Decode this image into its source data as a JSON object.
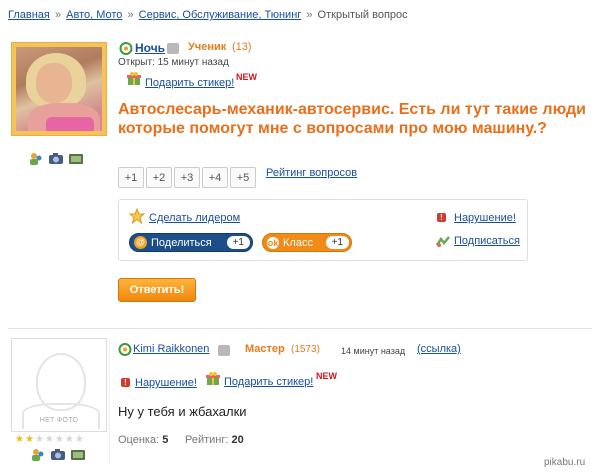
{
  "breadcrumb": {
    "items": [
      "Главная",
      "Авто, Мото",
      "Сервис, Обслуживание, Тюнинг"
    ],
    "sep1": "»",
    "sep2": "»",
    "sep3": "»",
    "current": "Открытый вопрос"
  },
  "question": {
    "user_name": "Ночь",
    "rank": "Ученик",
    "rank_points": "(13)",
    "opened": "Открыт: 15 минут назад",
    "gift_label": "Подарить стикер!",
    "new_badge": "NEW",
    "title": "Автослесарь-механик-автосервис. Есть ли тут такие люди которые помогут мне с вопросами про мою машину.?",
    "votes": [
      "+1",
      "+2",
      "+3",
      "+4",
      "+5"
    ],
    "rating_link": "Рейтинг вопросов",
    "make_leader": "Сделать лидером",
    "violation": "Нарушение!",
    "share_label": "Поделиться",
    "share_count": "+1",
    "ok_label": "Класс",
    "ok_count": "+1",
    "subscribe": "Подписаться",
    "answer_button": "Ответить!"
  },
  "answer": {
    "user_name": "Kimi Raikkonen",
    "rank": "Мастер",
    "rank_points": "(1573)",
    "time": "14 минут назад",
    "link": "(ссылка)",
    "violation": "Нарушение!",
    "gift_label": "Подарить стикер!",
    "new_badge": "NEW",
    "text": "Ну у тебя и жбахалки",
    "score_label": "Оценка:",
    "score_value": "5",
    "rating_label": "Рейтинг:",
    "rating_value": "20",
    "stars": 2,
    "stars_total": 7,
    "no_photo": "НЕТ ФОТО"
  },
  "watermark": "pikabu.ru",
  "colors": {
    "link": "#1a4ea0",
    "accent_orange": "#e8701d",
    "share_blue": "#1c4f8a",
    "ok_orange": "#f08b17"
  }
}
